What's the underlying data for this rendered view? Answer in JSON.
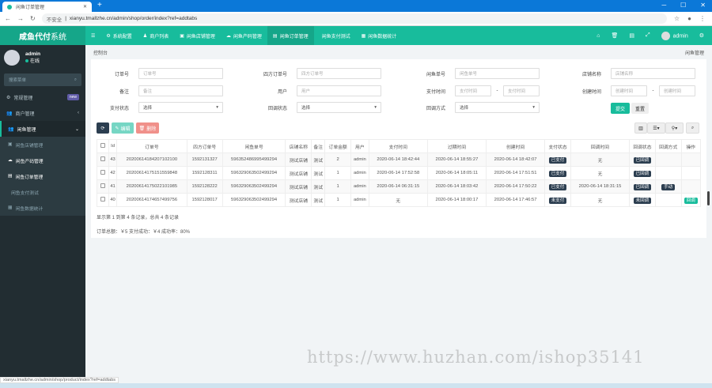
{
  "browser": {
    "tab_title": "闲鱼订单管理",
    "insecure": "不安全",
    "url": "xianyu.tmallzhe.cn/admin/shop/order/index?ref=addtabs",
    "status_url": "xianyu.tmallzhe.cn/admin/shop/product/index?ref=addtabs"
  },
  "header": {
    "logo_bold": "咸鱼代付",
    "logo_rest": "系统",
    "nav": [
      "系统配置",
      "商户列表",
      "闲鱼店铺管理",
      "闲鱼产码管理",
      "闲鱼订单管理",
      "闲鱼支付测试",
      "闲鱼数据统计"
    ],
    "active_nav": 4,
    "user": "admin"
  },
  "sidebar": {
    "user": "admin",
    "status": "在线",
    "search_placeholder": "搜索菜单",
    "items": [
      {
        "label": "常规管理",
        "badge": "new"
      },
      {
        "label": "商户管理"
      },
      {
        "label": "闲鱼管理"
      }
    ],
    "sub": [
      "闲鱼店铺管理",
      "闲鱼产码管理",
      "闲鱼订单管理",
      "闲鱼支付测试",
      "闲鱼数据统计"
    ]
  },
  "breadcrumb": {
    "left": "控制台",
    "right": "闲鱼管理"
  },
  "filters": {
    "order_no": {
      "label": "订单号",
      "placeholder": "订单号"
    },
    "sifang_no": {
      "label": "四方订单号",
      "placeholder": "四方订单号"
    },
    "xianyu_no": {
      "label": "闲鱼单号",
      "placeholder": "闲鱼单号"
    },
    "shop": {
      "label": "店铺名称",
      "placeholder": "店铺名称"
    },
    "remark": {
      "label": "备注",
      "placeholder": "备注"
    },
    "user": {
      "label": "用户",
      "placeholder": "用户"
    },
    "pay_time": {
      "label": "支付时间",
      "placeholder": "支付时间"
    },
    "create_time": {
      "label": "创建时间",
      "placeholder": "创建时间"
    },
    "pay_status": {
      "label": "支付状态",
      "value": "选择"
    },
    "cb_status": {
      "label": "回调状态",
      "value": "选择"
    },
    "cb_method": {
      "label": "回调方式",
      "value": "选择"
    },
    "submit": "提交",
    "reset": "重置",
    "dash": "-"
  },
  "toolbar": {
    "edit": "编辑",
    "delete": "删除"
  },
  "table": {
    "columns": [
      "Id",
      "订单号",
      "四方订单号",
      "闲鱼单号",
      "店铺名称",
      "备注",
      "订单金额",
      "用户",
      "支付时间",
      "过期时间",
      "创建时间",
      "支付状态",
      "回调时间",
      "回调状态",
      "回调方式",
      "操作"
    ],
    "rows": [
      [
        "43",
        "20200614184207102100",
        "1592131327",
        "596352486995499294",
        "测试店铺",
        "测试",
        "2",
        "admin",
        "2020-06-14 18:42:44",
        "2020-06-14 18:55:27",
        "2020-06-14 18:42:07",
        "已支付",
        "无",
        "已回调",
        "",
        ""
      ],
      [
        "42",
        "20200614175151559848",
        "1592128311",
        "596329063502499294",
        "测试店铺",
        "测试",
        "1",
        "admin",
        "2020-06-14 17:52:58",
        "2020-06-14 18:05:11",
        "2020-06-14 17:51:51",
        "已支付",
        "无",
        "已回调",
        "",
        ""
      ],
      [
        "41",
        "20200614175022101985",
        "1592128222",
        "596329063502499294",
        "测试店铺",
        "测试",
        "1",
        "admin",
        "2020-06-14 06:31:15",
        "2020-06-14 18:03:42",
        "2020-06-14 17:50:22",
        "已支付",
        "2020-06-14 18:31:15",
        "已回调",
        "手动",
        ""
      ],
      [
        "40",
        "20200614174657499756",
        "1592128017",
        "596329063502499294",
        "测试店铺",
        "测试",
        "1",
        "admin",
        "无",
        "2020-06-14 18:00:17",
        "2020-06-14 17:46:57",
        "未支付",
        "无",
        "未回调",
        "",
        "回调"
      ]
    ]
  },
  "pagination_info": "显示第 1 到第 4 条记录，总共 4 条记录",
  "summary": "订单总额：￥5 支付成功：￥4 成功率：80%",
  "watermark": "https://www.huzhan.com/ishop35141"
}
